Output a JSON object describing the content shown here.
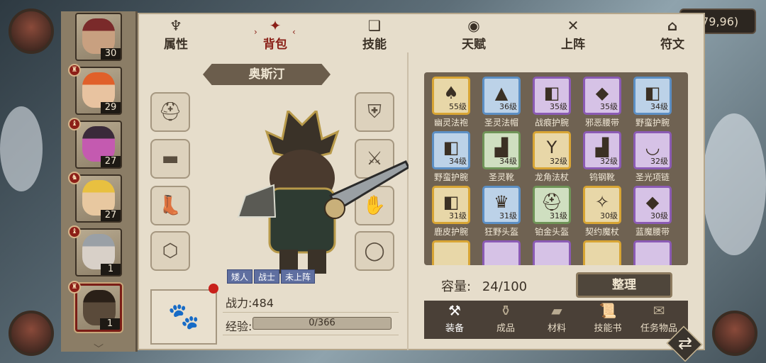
{
  "world": {
    "coordinates": "(79,96)"
  },
  "hero_list": [
    {
      "level": "30",
      "face": "#c8a080",
      "hair": "#7a2a2a",
      "badge": ""
    },
    {
      "level": "29",
      "face": "#e8c3a0",
      "hair": "#e0602a",
      "badge": "♜"
    },
    {
      "level": "27",
      "face": "#c45ab0",
      "hair": "#3a2a3a",
      "badge": "♝"
    },
    {
      "level": "27",
      "face": "#e8c8a0",
      "hair": "#e8c040",
      "badge": "♞"
    },
    {
      "level": "1",
      "face": "#d8d0c8",
      "hair": "#9aa0a6",
      "badge": "♝"
    },
    {
      "level": "1",
      "face": "#5a4a3a",
      "hair": "#2a2018",
      "badge": "♜"
    }
  ],
  "tabs": [
    {
      "label": "属性",
      "icon": "♆"
    },
    {
      "label": "背包",
      "icon": "✦"
    },
    {
      "label": "技能",
      "icon": "❑"
    },
    {
      "label": "天赋",
      "icon": "◉"
    },
    {
      "label": "上阵",
      "icon": "✕"
    },
    {
      "label": "符文",
      "icon": "⌂"
    }
  ],
  "active_tab_index": 1,
  "hero": {
    "name": "奥斯汀",
    "tags": [
      "矮人",
      "战士",
      "未上阵"
    ],
    "power_label": "战力:484",
    "exp_label": "经验:",
    "exp_value": "0/366",
    "exp_progress": 0
  },
  "equipment_slots": {
    "left": [
      "helmet-slot",
      "belt-slot",
      "boots-slot",
      "ring-slot"
    ],
    "right": [
      "armor-slot",
      "weapon-slot",
      "gloves-slot",
      "necklace-slot"
    ],
    "left_icons": [
      "⛑",
      "▬",
      "👢",
      "⬡"
    ],
    "right_icons": [
      "⛨",
      "⚔",
      "✋",
      "◯"
    ]
  },
  "inventory": {
    "items": [
      {
        "name": "幽灵法袍",
        "level": "55级",
        "quality": "gold",
        "glyph": "♠"
      },
      {
        "name": "圣灵法帽",
        "level": "36级",
        "quality": "blue",
        "glyph": "▲"
      },
      {
        "name": "战痕护腕",
        "level": "35级",
        "quality": "purple",
        "glyph": "◧"
      },
      {
        "name": "邪恶腰带",
        "level": "35级",
        "quality": "purple",
        "glyph": "◆"
      },
      {
        "name": "野蛮护腕",
        "level": "34级",
        "quality": "blue",
        "glyph": "◧"
      },
      {
        "name": "野蛮护腕",
        "level": "34级",
        "quality": "blue",
        "glyph": "◧"
      },
      {
        "name": "圣灵靴",
        "level": "34级",
        "quality": "green",
        "glyph": "▟"
      },
      {
        "name": "龙角法杖",
        "level": "32级",
        "quality": "gold",
        "glyph": "Y"
      },
      {
        "name": "钨钢靴",
        "level": "32级",
        "quality": "purple",
        "glyph": "▟"
      },
      {
        "name": "圣光项链",
        "level": "32级",
        "quality": "purple",
        "glyph": "◡"
      },
      {
        "name": "鹿皮护腕",
        "level": "31级",
        "quality": "gold",
        "glyph": "◧"
      },
      {
        "name": "狂野头盔",
        "level": "31级",
        "quality": "blue",
        "glyph": "♛"
      },
      {
        "name": "铂金头盔",
        "level": "31级",
        "quality": "green",
        "glyph": "⛑"
      },
      {
        "name": "契约魔杖",
        "level": "30级",
        "quality": "gold",
        "glyph": "✧"
      },
      {
        "name": "蓝魔腰带",
        "level": "30级",
        "quality": "purple",
        "glyph": "◆"
      }
    ],
    "capacity_label": "容量:",
    "capacity_value": "24/100",
    "sort_label": "整理"
  },
  "categories": [
    {
      "label": "装备",
      "icon": "⚒"
    },
    {
      "label": "成品",
      "icon": "⚱"
    },
    {
      "label": "材料",
      "icon": "▰"
    },
    {
      "label": "技能书",
      "icon": "📜"
    },
    {
      "label": "任务物品",
      "icon": "✉"
    }
  ],
  "active_category_index": 0,
  "colors": {
    "panel": "#e6ddcb",
    "accent_red": "#8a1f17",
    "inventory_bg": "#6f6252"
  }
}
